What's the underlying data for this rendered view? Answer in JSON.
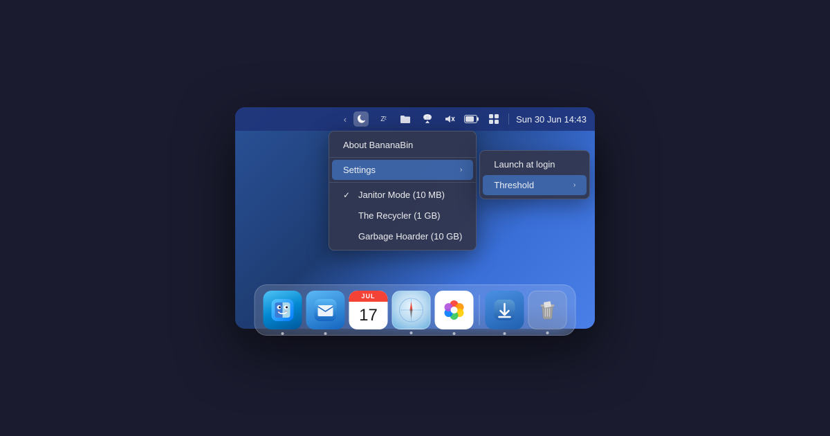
{
  "window": {
    "background_gradient": "linear-gradient(135deg, #2a5298, #1e3c72, #3a6fd8)"
  },
  "menubar": {
    "datetime": "Sun 30 Jun  14:43",
    "icons": [
      {
        "name": "chevron-left",
        "symbol": "‹",
        "active": false
      },
      {
        "name": "bananabin",
        "symbol": "🌙",
        "active": true
      },
      {
        "name": "sleep",
        "symbol": "ᶻ²",
        "active": false
      },
      {
        "name": "folder",
        "symbol": "📁",
        "active": false
      },
      {
        "name": "airdrop",
        "symbol": "◁▷",
        "active": false
      },
      {
        "name": "mute",
        "symbol": "🔇",
        "active": false
      },
      {
        "name": "battery",
        "symbol": "▭",
        "active": false
      },
      {
        "name": "controlcenter",
        "symbol": "⊟",
        "active": false
      }
    ]
  },
  "dropdown_main": {
    "items": [
      {
        "id": "about",
        "label": "About BananaBin",
        "has_arrow": false,
        "has_check": false,
        "checked": false
      },
      {
        "id": "separator1",
        "type": "separator"
      },
      {
        "id": "settings",
        "label": "Settings",
        "has_arrow": true,
        "has_check": false,
        "checked": false,
        "active": true
      },
      {
        "id": "separator2",
        "type": "separator"
      },
      {
        "id": "janitor",
        "label": "Janitor Mode (10 MB)",
        "has_arrow": false,
        "has_check": true,
        "checked": true
      },
      {
        "id": "recycler",
        "label": "The Recycler (1 GB)",
        "has_arrow": false,
        "has_check": true,
        "checked": false
      },
      {
        "id": "hoarder",
        "label": "Garbage Hoarder (10 GB)",
        "has_arrow": false,
        "has_check": true,
        "checked": false
      }
    ]
  },
  "submenu_settings": {
    "items": [
      {
        "id": "launch_login",
        "label": "Launch at login",
        "active": false
      },
      {
        "id": "threshold",
        "label": "Threshold",
        "has_arrow": true,
        "active": true
      }
    ]
  },
  "dock": {
    "icons": [
      {
        "id": "finder",
        "label": "Finder",
        "type": "finder"
      },
      {
        "id": "mail",
        "label": "Mail",
        "type": "mail"
      },
      {
        "id": "calendar",
        "label": "Calendar",
        "type": "calendar",
        "month": "JUL",
        "day": "17"
      },
      {
        "id": "safari",
        "label": "Safari",
        "type": "safari"
      },
      {
        "id": "photos",
        "label": "Photos",
        "type": "photos"
      }
    ],
    "divider": true,
    "right_icons": [
      {
        "id": "downloads",
        "label": "Downloads",
        "type": "downloads"
      },
      {
        "id": "trash",
        "label": "Trash",
        "type": "trash"
      }
    ]
  }
}
